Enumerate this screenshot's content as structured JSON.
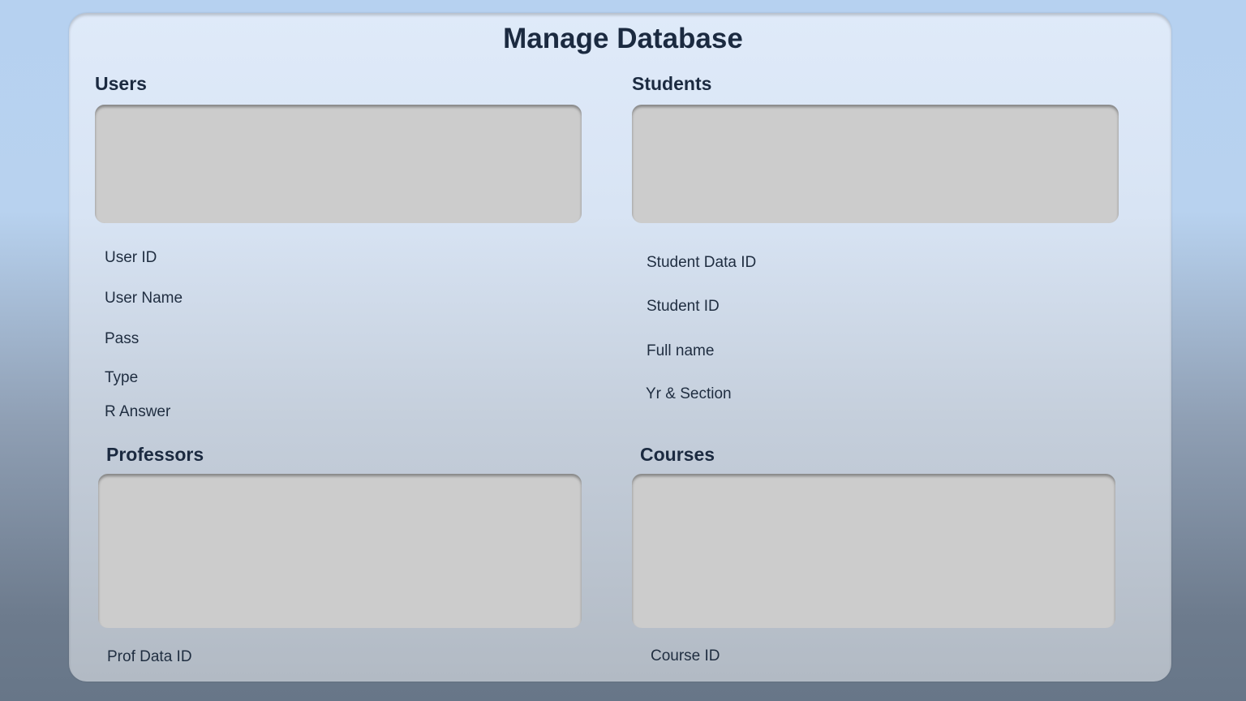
{
  "title": "Manage Database",
  "users": {
    "heading": "Users",
    "fields": [
      "User ID",
      "User Name",
      "Pass",
      "Type",
      "R Answer"
    ]
  },
  "students": {
    "heading": "Students",
    "fields": [
      "Student Data ID",
      "Student ID",
      "Full name",
      "Yr & Section"
    ]
  },
  "professors": {
    "heading": "Professors",
    "fields": [
      "Prof Data ID"
    ]
  },
  "courses": {
    "heading": "Courses",
    "fields": [
      "Course ID"
    ]
  }
}
